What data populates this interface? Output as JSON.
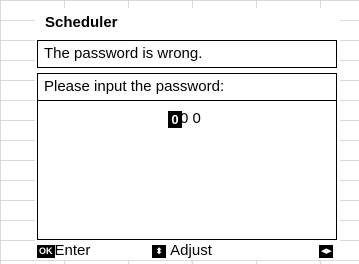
{
  "dialog": {
    "title": "Scheduler",
    "message": "The password is wrong.",
    "prompt": "Please input the password:",
    "password": {
      "active_digit": "0",
      "rest": "0 0"
    }
  },
  "footer": {
    "enter_key": "OK",
    "enter_label": "Enter",
    "adjust_key": "⬍",
    "adjust_label": "Adjust",
    "nav_key": "◀▶"
  }
}
